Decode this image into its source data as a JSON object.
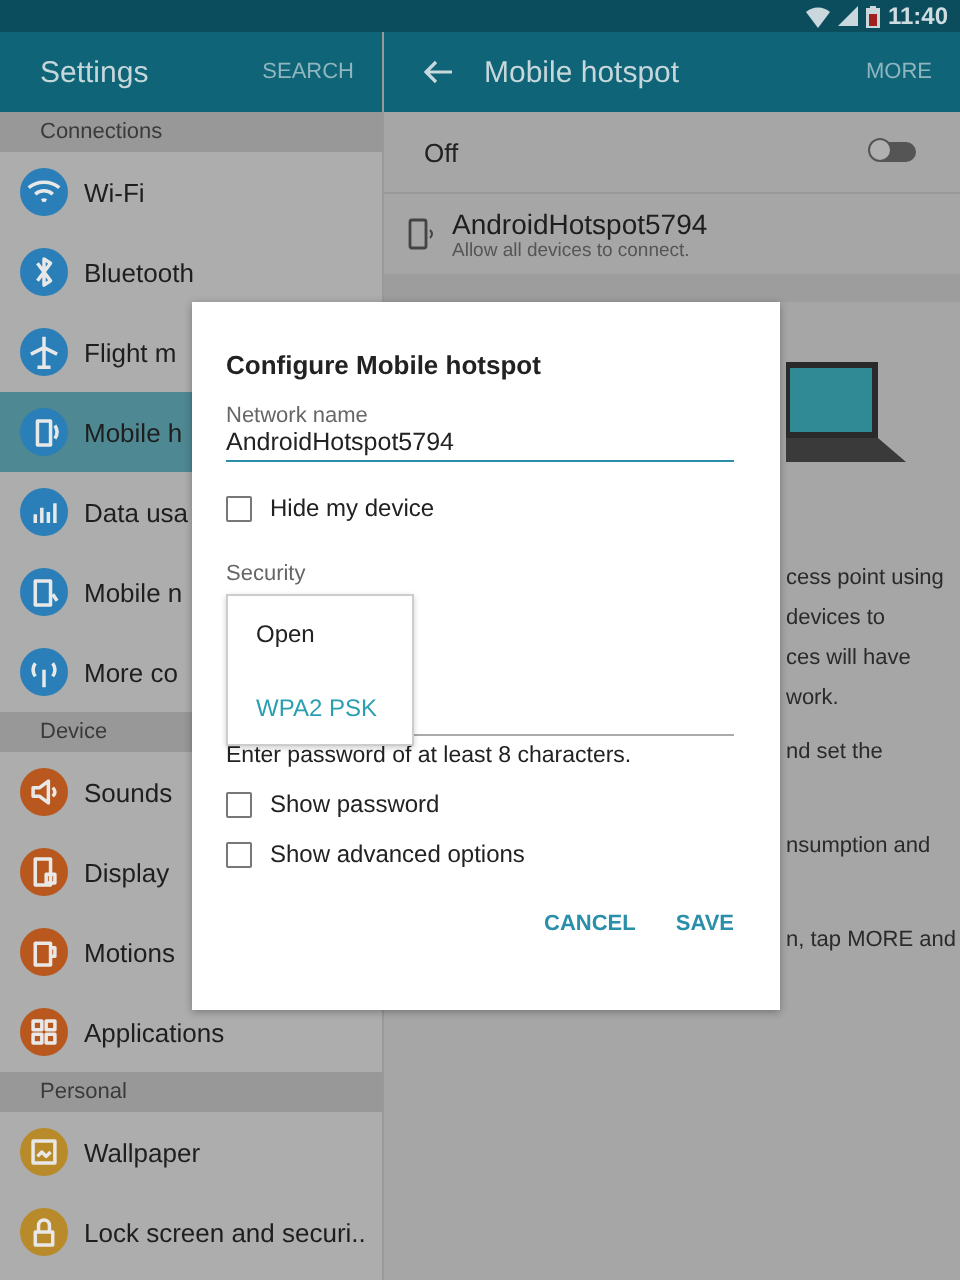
{
  "status_bar": {
    "time": "11:40"
  },
  "sidebar": {
    "title": "Settings",
    "action": "SEARCH",
    "sections": [
      {
        "header": "Connections",
        "items": [
          {
            "label": "Wi-Fi",
            "selected": false,
            "color": "#2a7fb8"
          },
          {
            "label": "Bluetooth",
            "selected": false,
            "color": "#2a7fb8"
          },
          {
            "label": "Flight m",
            "selected": false,
            "color": "#2a7fb8"
          },
          {
            "label": "Mobile h",
            "selected": true,
            "color": "#2a7fb8"
          },
          {
            "label": "Data usa",
            "selected": false,
            "color": "#2a7fb8"
          },
          {
            "label": "Mobile n",
            "selected": false,
            "color": "#2a7fb8"
          },
          {
            "label": "More co",
            "selected": false,
            "color": "#2a7fb8"
          }
        ]
      },
      {
        "header": "Device",
        "items": [
          {
            "label": "Sounds",
            "selected": false,
            "color": "#b8581f"
          },
          {
            "label": "Display",
            "selected": false,
            "color": "#b8581f"
          },
          {
            "label": "Motions",
            "selected": false,
            "color": "#b8581f"
          },
          {
            "label": "Applications",
            "selected": false,
            "color": "#b8581f"
          }
        ]
      },
      {
        "header": "Personal",
        "items": [
          {
            "label": "Wallpaper",
            "selected": false,
            "color": "#b88a2a"
          },
          {
            "label": "Lock screen and securi..",
            "selected": false,
            "color": "#b88a2a"
          }
        ]
      }
    ]
  },
  "content": {
    "title": "Mobile hotspot",
    "action": "MORE",
    "switch_row": {
      "label": "Off",
      "on": false
    },
    "hotspot": {
      "name": "AndroidHotspot5794",
      "subtitle": "Allow all devices to connect."
    },
    "paragraphs": [
      [
        "cess point using",
        "devices to",
        "ces will have",
        "work."
      ],
      [
        "nd set the"
      ],
      [
        "nsumption and"
      ],
      [
        "n, tap MORE and"
      ]
    ]
  },
  "dialog": {
    "title": "Configure Mobile hotspot",
    "network_field": {
      "label": "Network name",
      "value": "AndroidHotspot5794"
    },
    "hide_device": {
      "label": "Hide my device",
      "checked": false
    },
    "security": {
      "label": "Security",
      "options": [
        {
          "label": "Open",
          "selected": false
        },
        {
          "label": "WPA2 PSK",
          "selected": true
        }
      ]
    },
    "hint": "Enter password of at least 8 characters.",
    "checkboxes": [
      {
        "label": "Show password",
        "checked": false
      },
      {
        "label": "Show advanced options",
        "checked": false
      }
    ],
    "buttons": [
      "CANCEL",
      "SAVE"
    ]
  }
}
